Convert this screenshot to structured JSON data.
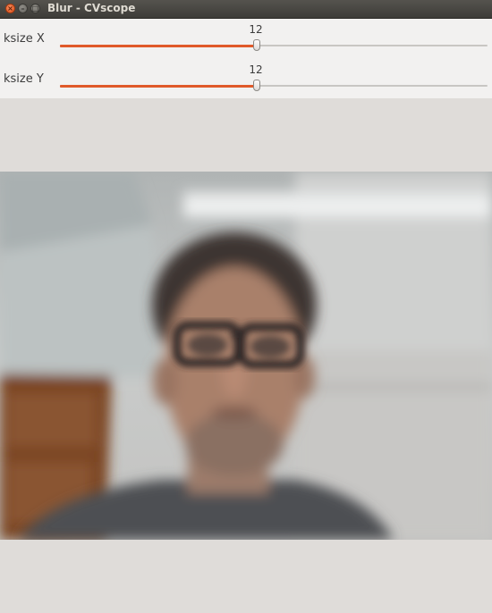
{
  "window": {
    "title": "Blur - CVscope",
    "close_glyph": "×",
    "minimize_glyph": "–",
    "maximize_glyph": "□"
  },
  "trackbars": [
    {
      "label": "ksize X",
      "value": 12,
      "max": 25,
      "fill_fraction": 0.46
    },
    {
      "label": "ksize Y",
      "value": 12,
      "max": 25,
      "fill_fraction": 0.46
    }
  ],
  "colors": {
    "slider_fill": "#e05a2a",
    "titlebar": "#3d3c38",
    "panel_bg": "#f2f1f0",
    "window_bg": "#dfdcd9"
  },
  "icons": {
    "close": "close-icon",
    "minimize": "minimize-icon",
    "maximize": "maximize-icon"
  }
}
